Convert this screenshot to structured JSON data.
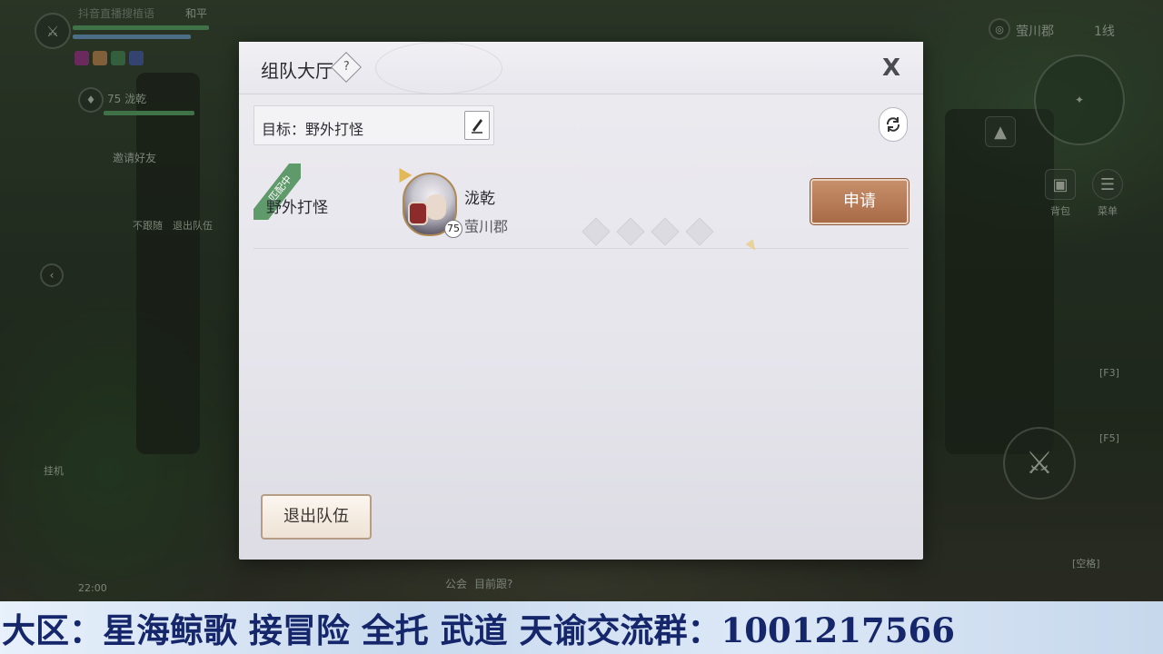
{
  "hud": {
    "player_name_blurred": "抖音直播搜植语",
    "pk_mode": "和平",
    "team_member_level_name": "75 泷乾",
    "invite_friend": "邀请好友",
    "follow_label": "不跟随",
    "leave_team_label": "退出队伍",
    "auto_label": "挂机",
    "time": "22:00",
    "location": "萤川郡",
    "channel": "1线",
    "chat_channel": "公会",
    "chat_preview": "目前跟?",
    "bag_label": "背包",
    "menu_label": "菜单",
    "right_labels": [
      "[F3]",
      "[F5]",
      "[空格]"
    ]
  },
  "dialog": {
    "title": "组队大厅",
    "help": "?",
    "close": "X",
    "target_label": "目标：野外打怪",
    "team": {
      "status_ribbon": "匹配中",
      "goal": "野外打怪",
      "leader_name": "泷乾",
      "leader_level": "75",
      "leader_server": "萤川郡",
      "apply_label": "申请",
      "empty_slots": 4
    },
    "leave_team_button": "退出队伍"
  },
  "banner": {
    "text": "大区：星海鲸歌 接冒险 全托 武道 天谕交流群：1001217566"
  },
  "colors": {
    "ribbon": "#5f9a6a",
    "apply_button": "#b57a55",
    "banner_text": "#15266b"
  }
}
